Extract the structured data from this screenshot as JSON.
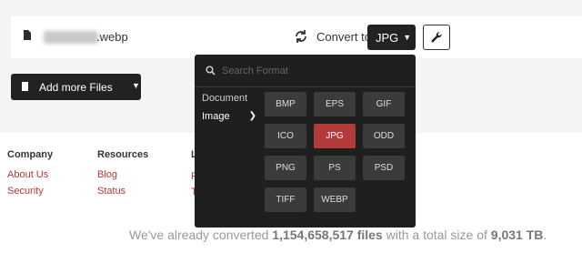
{
  "file_row": {
    "file_name_ext": ".webp",
    "convert_to_label": "Convert to",
    "selected_format": "JPG"
  },
  "add_files": {
    "label": "Add more Files"
  },
  "footer": {
    "company": {
      "heading": "Company",
      "links": [
        "About Us",
        "Security"
      ]
    },
    "resources": {
      "heading": "Resources",
      "links": [
        "Blog",
        "Status"
      ]
    },
    "third_heading_fragment": "L",
    "third_links_fragments": [
      "F",
      "T"
    ]
  },
  "stats": {
    "prefix": "We've already converted ",
    "files_count": "1,154,658,517 files",
    "middle": " with a total size of ",
    "total_size": "9,031 TB",
    "suffix": "."
  },
  "dropdown": {
    "search_placeholder": "Search Format",
    "categories": [
      {
        "label": "Document",
        "active": false
      },
      {
        "label": "Image",
        "active": true
      }
    ],
    "formats": [
      "BMP",
      "EPS",
      "GIF",
      "ICO",
      "JPG",
      "ODD",
      "PNG",
      "PS",
      "PSD",
      "TIFF",
      "WEBP"
    ],
    "selected": "JPG"
  },
  "colors": {
    "accent": "#b33a3a",
    "dark": "#222222"
  },
  "icons": {
    "file": "file-icon",
    "refresh": "refresh-icon",
    "wrench": "wrench-icon",
    "search": "search-icon",
    "chevron": "chevron-down-icon"
  }
}
